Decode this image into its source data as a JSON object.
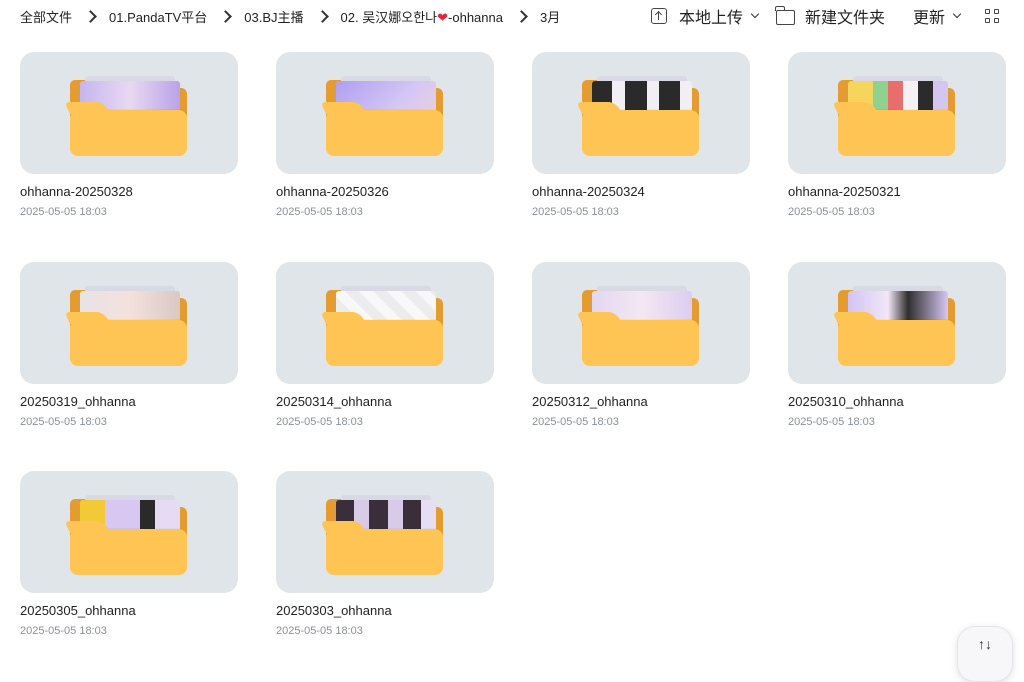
{
  "breadcrumb": [
    {
      "label": "全部文件"
    },
    {
      "label": "01.PandaTV平台"
    },
    {
      "label": "03.BJ主播"
    },
    {
      "label_before": "02. 吴汉娜오한나",
      "heart": "❤",
      "label_after": "-ohhanna"
    },
    {
      "label": "3月"
    }
  ],
  "toolbar": {
    "upload_label": "本地上传",
    "new_folder_label": "新建文件夹",
    "sort_label": "更新"
  },
  "folders": [
    {
      "name": "ohhanna-20250328",
      "date": "2025-05-05 18:03"
    },
    {
      "name": "ohhanna-20250326",
      "date": "2025-05-05 18:03"
    },
    {
      "name": "ohhanna-20250324",
      "date": "2025-05-05 18:03"
    },
    {
      "name": "ohhanna-20250321",
      "date": "2025-05-05 18:03"
    },
    {
      "name": "20250319_ohhanna",
      "date": "2025-05-05 18:03"
    },
    {
      "name": "20250314_ohhanna",
      "date": "2025-05-05 18:03"
    },
    {
      "name": "20250312_ohhanna",
      "date": "2025-05-05 18:03"
    },
    {
      "name": "20250310_ohhanna",
      "date": "2025-05-05 18:03"
    },
    {
      "name": "20250305_ohhanna",
      "date": "2025-05-05 18:03"
    },
    {
      "name": "20250303_ohhanna",
      "date": "2025-05-05 18:03"
    }
  ],
  "colors": {
    "folder_front": "#fec555",
    "folder_back": "#e49b2f",
    "card_bg": "#e0e5ea",
    "date_text": "#8a8f98",
    "heart": "#e0283d"
  },
  "float_button": {
    "icon": "↑↓"
  }
}
